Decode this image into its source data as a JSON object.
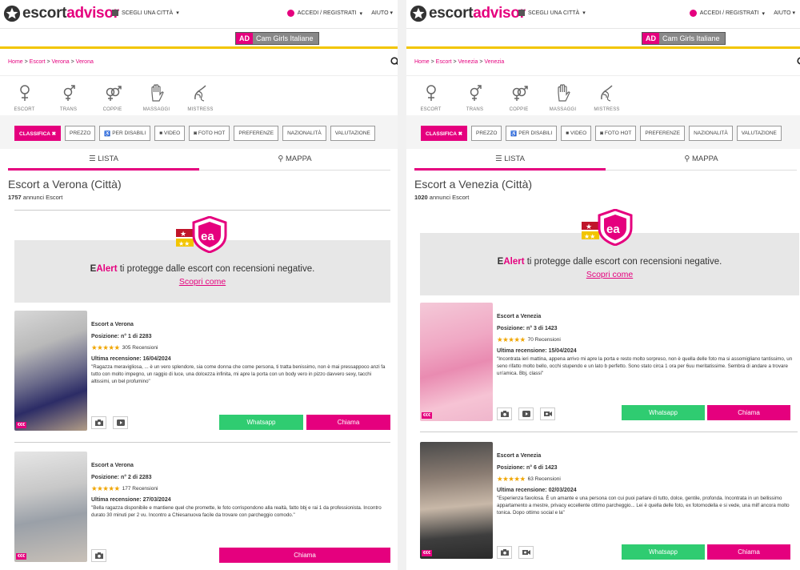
{
  "brand": {
    "name_part1": "escort",
    "name_part2": "advisor"
  },
  "header": {
    "citta_label": "SCEGLI UNA CITTÀ",
    "accedi_label": "ACCEDI / REGISTRATI",
    "aiuto_label": "AIUTO"
  },
  "ad": {
    "badge": "AD",
    "text": "Cam Girls Italiane"
  },
  "categories": [
    "ESCORT",
    "TRANS",
    "COPPIE",
    "MASSAGGI",
    "MISTRESS"
  ],
  "filters": {
    "classifica": "CLASSIFICA ✖",
    "prezzo": "PREZZO",
    "disabili": "PER DISABILI",
    "video": "VIDEO",
    "fotohot": "FOTO HOT",
    "preferenze": "PREFERENZE",
    "nazionalita": "NAZIONALITÀ",
    "valutazione": "VALUTAZIONE"
  },
  "tabs": {
    "lista": "LISTA",
    "mappa": "MAPPA"
  },
  "ealert": {
    "brand_e": "E",
    "brand_rest": "Alert",
    "text": " ti protegge dalle escort con recensioni negative.",
    "link": "Scopri come"
  },
  "buttons": {
    "whatsapp": "Whatsapp",
    "chiama": "Chiama"
  },
  "colors": {
    "accent": "#e5007e",
    "whatsapp": "#2fcc71",
    "stars": "#f0a500",
    "yellow": "#f2c500"
  },
  "left": {
    "breadcrumb": {
      "home": "Home",
      "escort": "Escort",
      "city": "Verona",
      "current": "Verona"
    },
    "title": "Escort a Verona (Città)",
    "count": "1757",
    "count_label": "annunci Escort",
    "cards": [
      {
        "location": "Escort a Verona",
        "position": "Posizione: n° 1 di 2283",
        "reviews": "305 Recensioni",
        "last_review": "Ultima recensione: 16/04/2024",
        "quote": "\"Ragazza meravigliosa, ... è un vero splendore, sia come donna che come persona, ti tratta benissimo, non è mai pressappoco anzi fa tutto con molto impegno, un raggio di luce, una dolcezza infinita, mi apre la porta con un body vero in pizzo davvero sexy, tacchi altissimi, un bel profumino\"",
        "price": "€€€"
      },
      {
        "location": "Escort a Verona",
        "position": "Posizione: n° 2 di 2283",
        "reviews": "177 Recensioni",
        "last_review": "Ultima recensione: 27/03/2024",
        "quote": "\"Bella ragazza disponibile e mantiene quel che promette, le foto corrispondono alla realtà, fatto bbj e rai 1 da professionista. Incontro durato 30 minuti per 2 vu. Incontro a Chiesanuova facile da trovare con parcheggio comodo.\"",
        "price": "€€€"
      }
    ]
  },
  "right": {
    "breadcrumb": {
      "home": "Home",
      "escort": "Escort",
      "city": "Venezia",
      "current": "Venezia"
    },
    "title": "Escort a Venezia (Città)",
    "count": "1020",
    "count_label": "annunci Escort",
    "cards": [
      {
        "location": "Escort a Venezia",
        "position": "Posizione: n° 3 di 1423",
        "reviews": "70 Recensioni",
        "last_review": "Ultima recensione: 15/04/2024",
        "quote": "\"Incontrata ieri mattina, appena arrivo mi apre la porta e resto molto sorpreso, non è quella delle foto ma si assomigliano tantissimo, un seno rifatto molto bello, occhi stupendo e un lato b perfetto. Sono stato circa 1 ora per 6uu meritatissime. Sembra di andare a trovare un'amica. Bbj, classi\"",
        "price": "€€€"
      },
      {
        "location": "Escort a Venezia",
        "position": "Posizione: n° 6 di 1423",
        "reviews": "63 Recensioni",
        "last_review": "Ultima recensione: 02/03/2024",
        "quote": "\"Esperienza favolosa. È un amante e una persona con cui puoi parlare di tutto, dolce, gentile, profonda. Incontrata in un bellissimo appartamento a mestre, privacy eccellente ottimo parcheggio... Lei è quella delle foto, ex fotomodella e si vede, una milf ancora molto tonica. Dopo ottimo social e la\"",
        "price": "€€€"
      }
    ]
  }
}
